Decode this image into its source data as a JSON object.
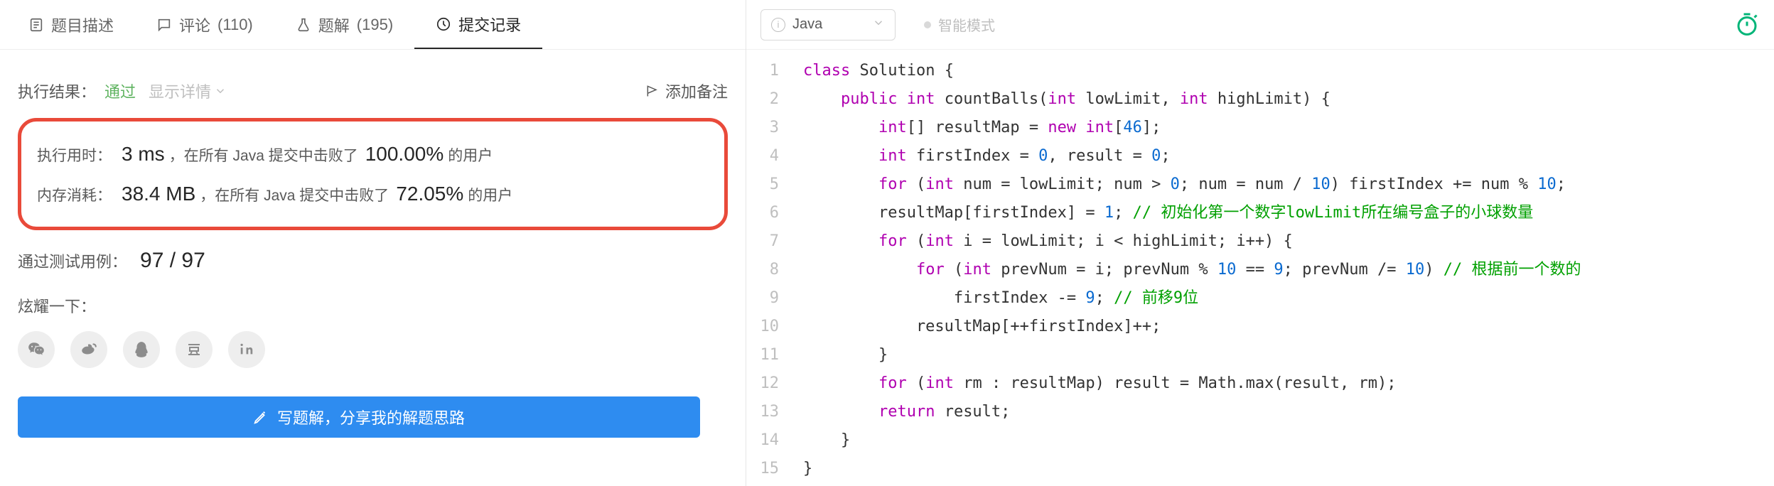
{
  "tabs": {
    "description": "题目描述",
    "comments_label": "评论",
    "comments_count": "(110)",
    "solutions_label": "题解",
    "solutions_count": "(195)",
    "submissions": "提交记录"
  },
  "result": {
    "label": "执行结果：",
    "status": "通过",
    "show_detail": "显示详情",
    "add_note": "添加备注"
  },
  "metrics": {
    "runtime_label": "执行用时：",
    "runtime_value": "3 ms",
    "runtime_text1": "，在所有 Java 提交中击败了",
    "runtime_pct": "100.00%",
    "runtime_text2": "的用户",
    "memory_label": "内存消耗：",
    "memory_value": "38.4 MB",
    "memory_text1": "，在所有 Java 提交中击败了",
    "memory_pct": "72.05%",
    "memory_text2": "的用户"
  },
  "testcases": {
    "label": "通过测试用例：",
    "value": "97 / 97"
  },
  "share": {
    "label": "炫耀一下："
  },
  "write_solution": "写题解，分享我的解题思路",
  "editor": {
    "language": "Java",
    "smart_mode": "智能模式"
  },
  "code_lines": [
    {
      "n": 1,
      "html": "<span class='kw'>class</span> <span class='id'>Solution</span> {"
    },
    {
      "n": 2,
      "html": "    <span class='kw'>public</span> <span class='type'>int</span> <span class='fn'>countBalls</span>(<span class='type'>int</span> lowLimit, <span class='type'>int</span> highLimit) {"
    },
    {
      "n": 3,
      "html": "        <span class='type'>int</span>[] resultMap = <span class='new'>new</span> <span class='type'>int</span>[<span class='num'>46</span>];"
    },
    {
      "n": 4,
      "html": "        <span class='type'>int</span> firstIndex = <span class='num'>0</span>, result = <span class='num'>0</span>;"
    },
    {
      "n": 5,
      "html": "        <span class='kw'>for</span> (<span class='type'>int</span> num = lowLimit; num &gt; <span class='num'>0</span>; num = num / <span class='num'>10</span>) firstIndex += num % <span class='num'>10</span>;"
    },
    {
      "n": 6,
      "html": "        resultMap[firstIndex] = <span class='num'>1</span>; <span class='cmt'>// 初始化第一个数字lowLimit所在编号盒子的小球数量</span>"
    },
    {
      "n": 7,
      "html": "        <span class='kw'>for</span> (<span class='type'>int</span> i = lowLimit; i &lt; highLimit; i++) {"
    },
    {
      "n": 8,
      "html": "            <span class='kw'>for</span> (<span class='type'>int</span> prevNum = i; prevNum % <span class='num'>10</span> == <span class='num'>9</span>; prevNum /= <span class='num'>10</span>) <span class='cmt'>// 根据前一个数的</span>"
    },
    {
      "n": 9,
      "html": "                firstIndex -= <span class='num'>9</span>; <span class='cmt'>// 前移9位</span>"
    },
    {
      "n": 10,
      "html": "            resultMap[++firstIndex]++;"
    },
    {
      "n": 11,
      "html": "        }"
    },
    {
      "n": 12,
      "html": "        <span class='kw'>for</span> (<span class='type'>int</span> rm : resultMap) result = Math.max(result, rm);"
    },
    {
      "n": 13,
      "html": "        <span class='kw'>return</span> result;"
    },
    {
      "n": 14,
      "html": "    }"
    },
    {
      "n": 15,
      "html": "}"
    }
  ]
}
